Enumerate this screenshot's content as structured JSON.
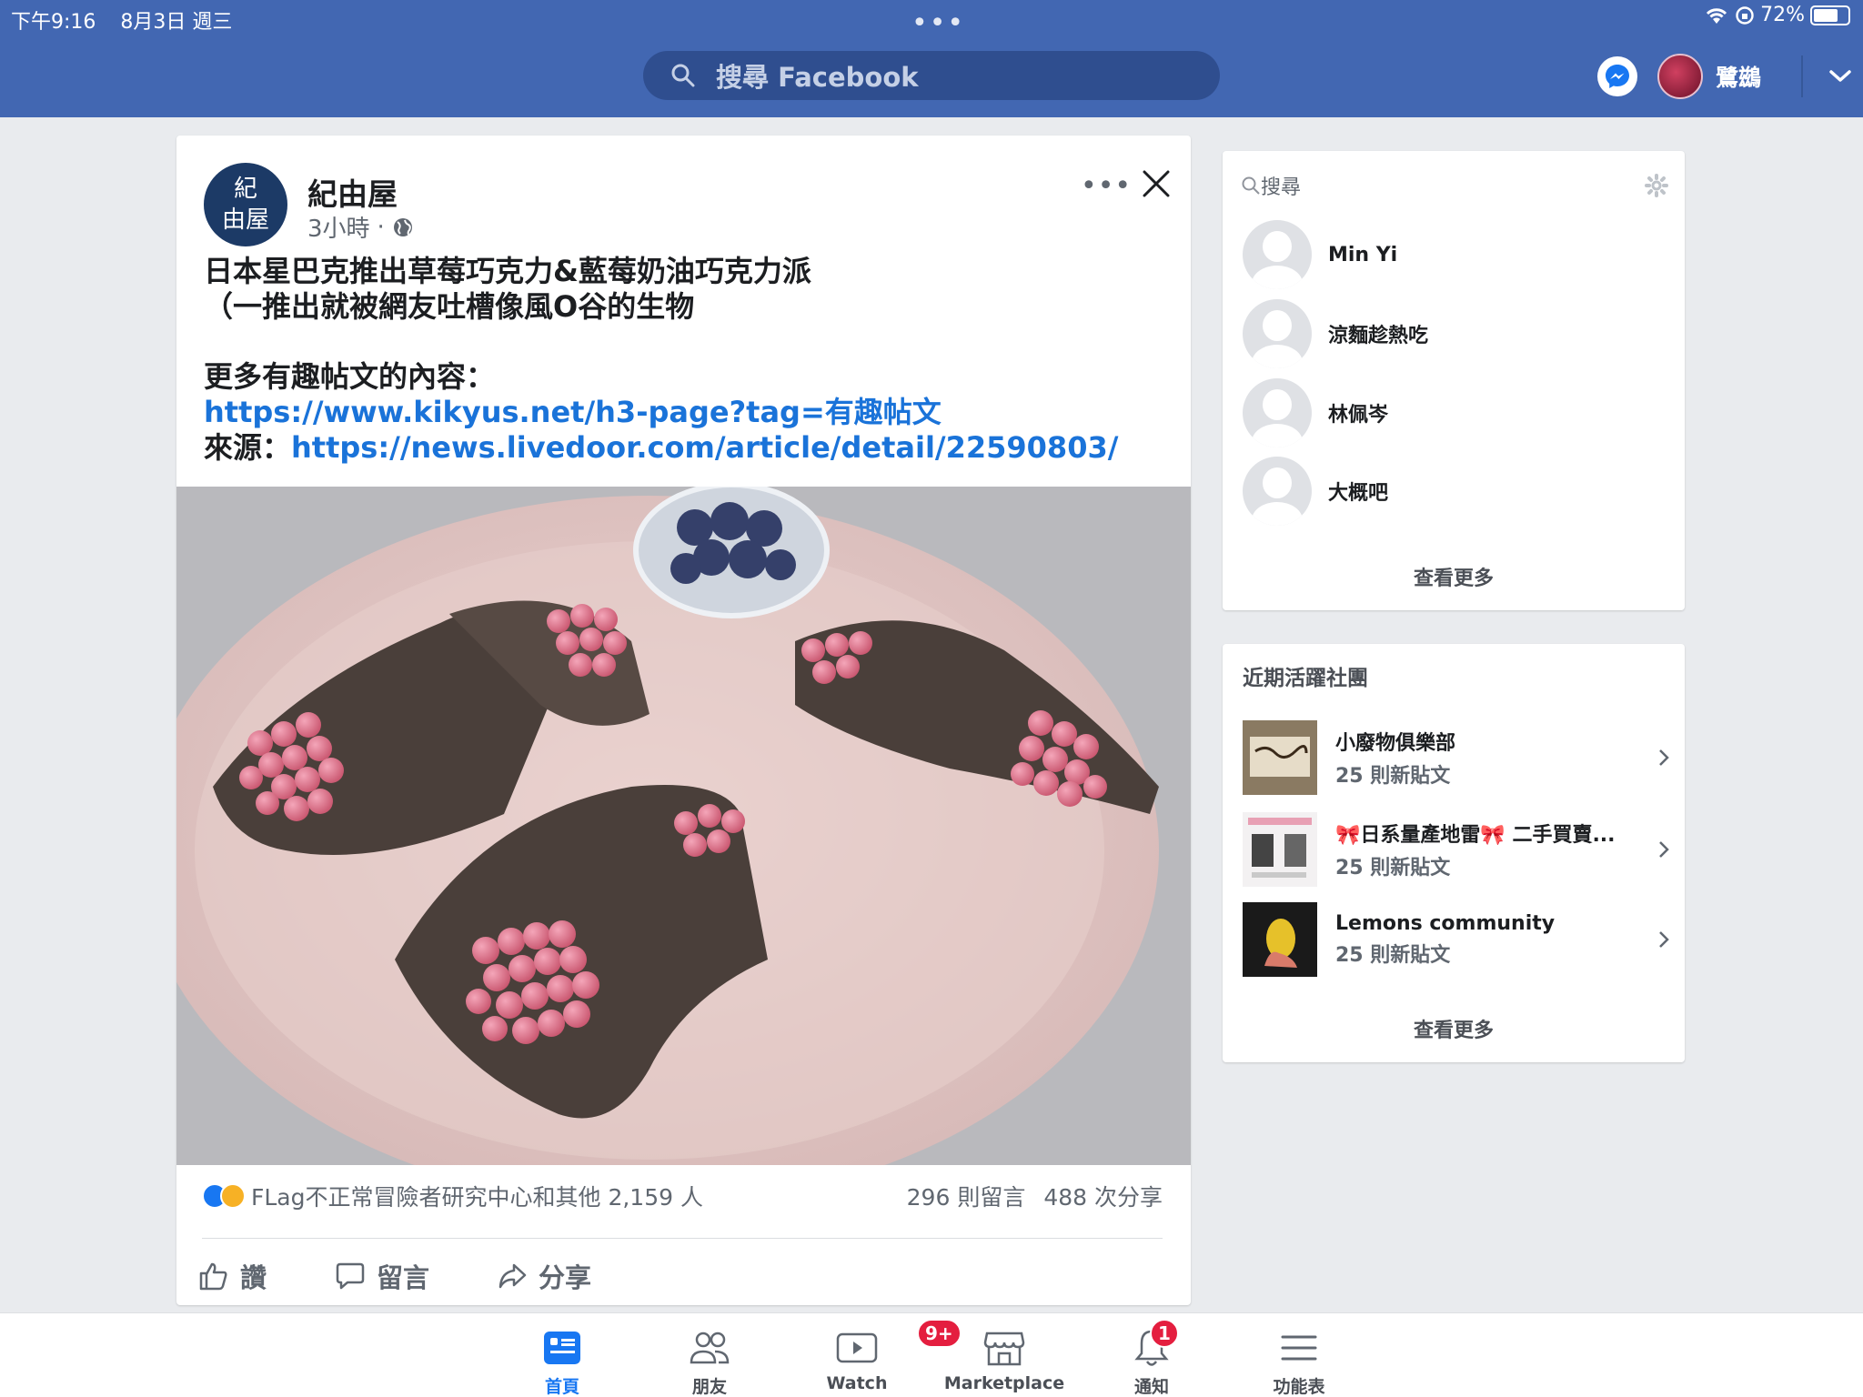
{
  "status_bar": {
    "time": "下午9:16",
    "date": "8月3日 週三",
    "battery": "72%",
    "battery_fraction": 0.72,
    "dots": "•••"
  },
  "header": {
    "search_placeholder": "搜尋 Facebook",
    "user_name": "鷺鷀",
    "brand_color": "#4267b2"
  },
  "post": {
    "page_logo_line1": "紀",
    "page_logo_line2": "由屋",
    "page_name": "紀由屋",
    "time": "3小時",
    "dot": "·",
    "more": "•••",
    "text_line1": "日本星巴克推出草莓巧克力&藍莓奶油巧克力派",
    "text_line2": "（一推出就被網友吐槽像風O谷的生物",
    "text_line3": "更多有趣帖文的內容：",
    "link1": "https://www.kikyus.net/h3-page?tag=有趣帖文",
    "source_label": "來源：",
    "link2": "https://news.livedoor.com/article/detail/22590803/",
    "reactions": "FLag不正常冒險者研究中心和其他 2,159 人",
    "comments": "296 則留言",
    "shares": "488 次分享",
    "like_label": "讚",
    "comment_label": "留言",
    "share_label": "分享"
  },
  "contacts": {
    "search_placeholder": "搜尋",
    "items": [
      {
        "name": "Min Yi"
      },
      {
        "name": "涼麵趁熱吃"
      },
      {
        "name": "林佩岑"
      },
      {
        "name": "大概吧"
      }
    ],
    "see_more": "查看更多"
  },
  "groups": {
    "title": "近期活躍社團",
    "items": [
      {
        "name": "小廢物俱樂部",
        "count": "25 則新貼文"
      },
      {
        "name": "🎀日系量產地雷🎀 二手買賣...",
        "count": "25 則新貼文"
      },
      {
        "name": "Lemons community",
        "count": "25 則新貼文"
      }
    ],
    "see_more": "查看更多"
  },
  "bottom_nav": {
    "tabs": [
      {
        "label": "首頁"
      },
      {
        "label": "朋友"
      },
      {
        "label": "Watch",
        "badge": "9+"
      },
      {
        "label": "Marketplace"
      },
      {
        "label": "通知",
        "badge": "1"
      },
      {
        "label": "功能表"
      }
    ]
  }
}
